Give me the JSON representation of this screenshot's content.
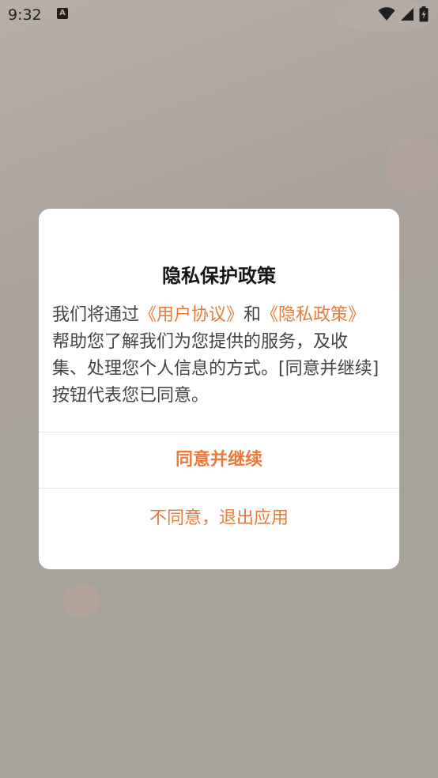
{
  "status_bar": {
    "time": "9:32",
    "notification_icon_letter": "A",
    "icons": [
      "wifi-icon",
      "signal-icon",
      "battery-charging-icon"
    ]
  },
  "dialog": {
    "title": "隐私保护政策",
    "body": {
      "intro": "我们将通过",
      "link_user_agreement": "《用户协议》",
      "and": "和",
      "link_privacy_policy": "《隐私政策》",
      "rest": "帮助您了解我们为您提供的服务，及收集、处理您个人信息的方式。[同意并继续]按钮代表您已同意。"
    },
    "agree_button": "同意并继续",
    "decline_button": "不同意，退出应用"
  },
  "colors": {
    "accent": "#e97a3a",
    "dialog_bg": "#ffffff",
    "scrim": "#a9a19b",
    "body_text": "#444444",
    "title_text": "#151515"
  }
}
